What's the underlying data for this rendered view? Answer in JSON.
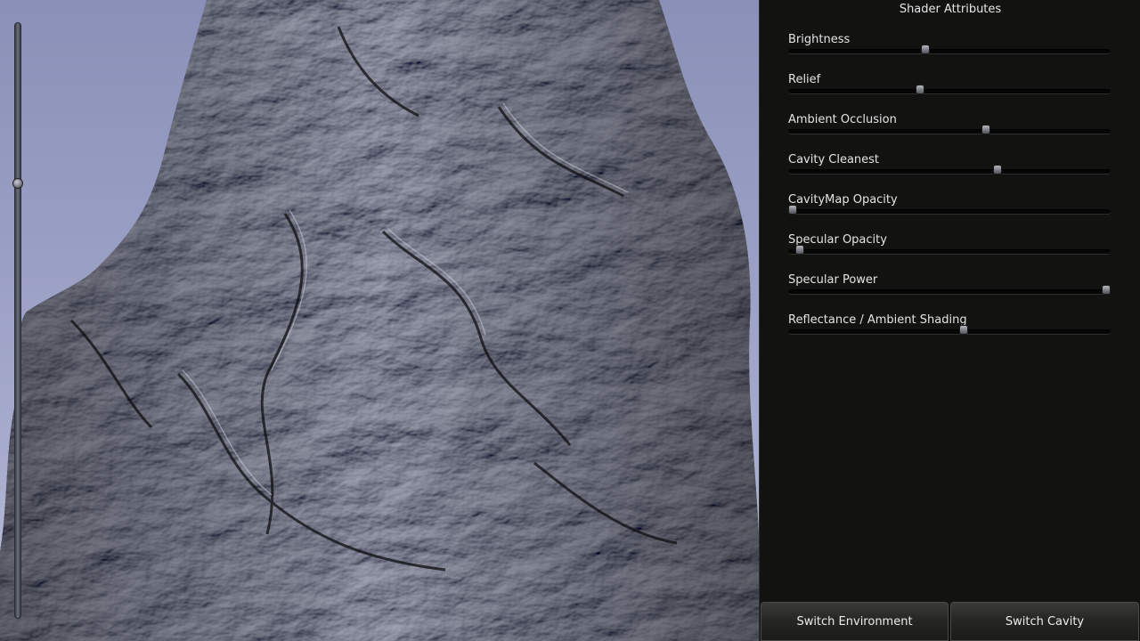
{
  "panel": {
    "title": "Shader Attributes",
    "sliders": [
      {
        "label": "Brightness",
        "value": 0.425
      },
      {
        "label": "Relief",
        "value": 0.408
      },
      {
        "label": "Ambient Occlusion",
        "value": 0.613
      },
      {
        "label": "Cavity Cleanest",
        "value": 0.65
      },
      {
        "label": "CavityMap Opacity",
        "value": 0.015
      },
      {
        "label": "Specular Opacity",
        "value": 0.037
      },
      {
        "label": "Specular Power",
        "value": 0.985
      },
      {
        "label": "Reflectance / Ambient Shading",
        "value": 0.544
      }
    ]
  },
  "buttons": {
    "switch_environment": "Switch Environment",
    "switch_cavity": "Switch Cavity"
  },
  "viewport": {
    "zoom_value": 0.27
  },
  "colors": {
    "panel_bg": "#121311",
    "sky": "#9a9fc4",
    "text": "#e4e4e4"
  }
}
